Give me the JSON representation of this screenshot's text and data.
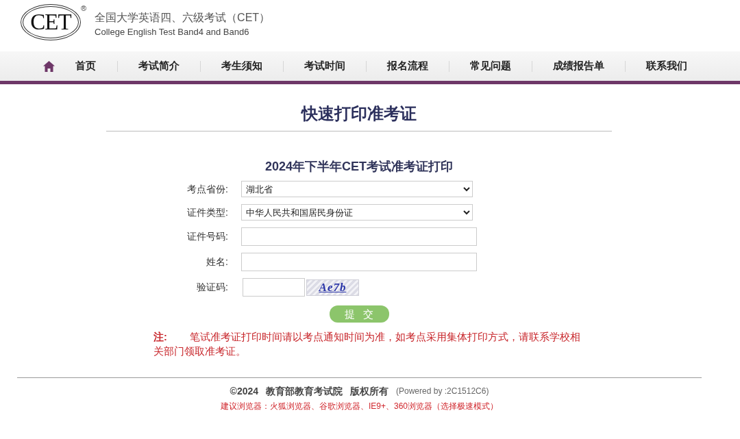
{
  "header": {
    "logo": "CET",
    "registered_mark": "®",
    "title": "全国大学英语四、六级考试（CET）",
    "subtitle": "College English Test Band4 and Band6"
  },
  "nav": {
    "items": [
      "首页",
      "考试简介",
      "考生须知",
      "考试时间",
      "报名流程",
      "常见问题",
      "成绩报告单",
      "联系我们"
    ]
  },
  "page_title": "快速打印准考证",
  "form": {
    "title": "2024年下半年CET考试准考证打印",
    "fields": [
      {
        "kind": "select",
        "label": "考点省份:",
        "value": "湖北省"
      },
      {
        "kind": "select",
        "label": "证件类型:",
        "value": "中华人民共和国居民身份证"
      },
      {
        "kind": "text",
        "label": "证件号码:"
      },
      {
        "kind": "text",
        "label": "姓名:"
      },
      {
        "kind": "captcha",
        "label": "验证码:",
        "captcha": "Ae7b"
      }
    ],
    "submit": "提 交"
  },
  "note": "**注:** 笔试准考证打印时间请以考点通知时间为准，如考点采用集体打印方式，请联系学校相关部门领取准考证。",
  "footer": {
    "copyright": [
      "©2024",
      "教育部教育考试院",
      "版权所有"
    ],
    "powered_by": "(Powered by :2C1512C6)",
    "browsers": "建议浏览器：火狐浏览器、谷歌浏览器、IE9+、360浏览器（选择极速模式）"
  }
}
